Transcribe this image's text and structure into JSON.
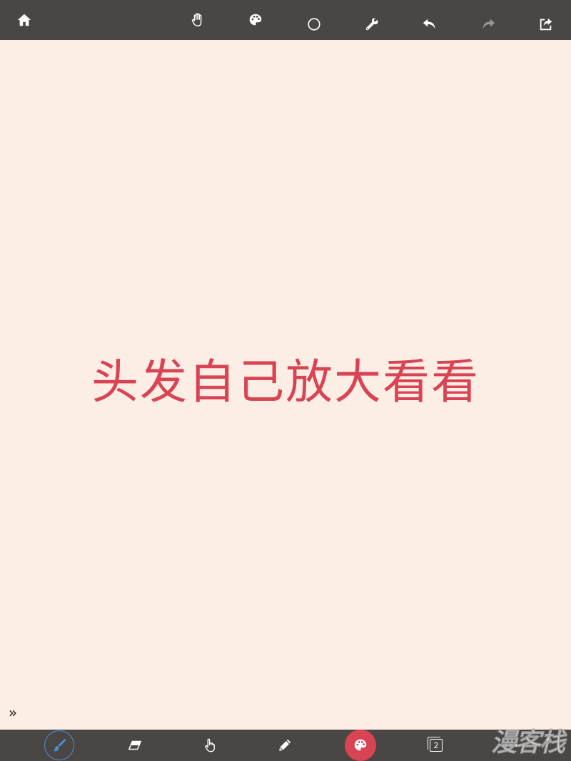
{
  "toolbar_top": {
    "items": [
      {
        "name": "home-button",
        "icon": "home-icon"
      },
      {
        "name": "hand-tool-button",
        "icon": "hand-icon"
      },
      {
        "name": "color-palette-button",
        "icon": "palette-icon"
      },
      {
        "name": "shape-tool-button",
        "icon": "circle-icon"
      },
      {
        "name": "settings-button",
        "icon": "wrench-icon"
      },
      {
        "name": "undo-button",
        "icon": "undo-icon"
      },
      {
        "name": "redo-button",
        "icon": "redo-icon",
        "disabled": true
      },
      {
        "name": "share-button",
        "icon": "share-icon"
      }
    ]
  },
  "canvas": {
    "text": "头发自己放大看看",
    "text_color": "#D94455",
    "background": "#FDEEE5"
  },
  "expand_toggle": {
    "glyph": "»"
  },
  "toolbar_bottom": {
    "active_tool": "brush",
    "current_color": "#D94455",
    "layer_count": "2",
    "items": [
      {
        "name": "brush-tool-button",
        "icon": "brush-icon",
        "active": true
      },
      {
        "name": "eraser-tool-button",
        "icon": "eraser-icon"
      },
      {
        "name": "finger-tool-button",
        "icon": "finger-icon"
      },
      {
        "name": "pencil-tool-button",
        "icon": "pencil-icon"
      },
      {
        "name": "color-picker-button",
        "icon": "palette-icon"
      },
      {
        "name": "layers-button",
        "icon": "layers-icon"
      },
      {
        "name": "more-button",
        "icon": "more-icon"
      }
    ]
  },
  "watermark": {
    "text": "漫客栈"
  },
  "colors": {
    "toolbar_bg": "#4A4644",
    "accent_blue": "#4A90D9",
    "icon_white": "#FFFFFF",
    "icon_disabled": "#9A9694"
  }
}
